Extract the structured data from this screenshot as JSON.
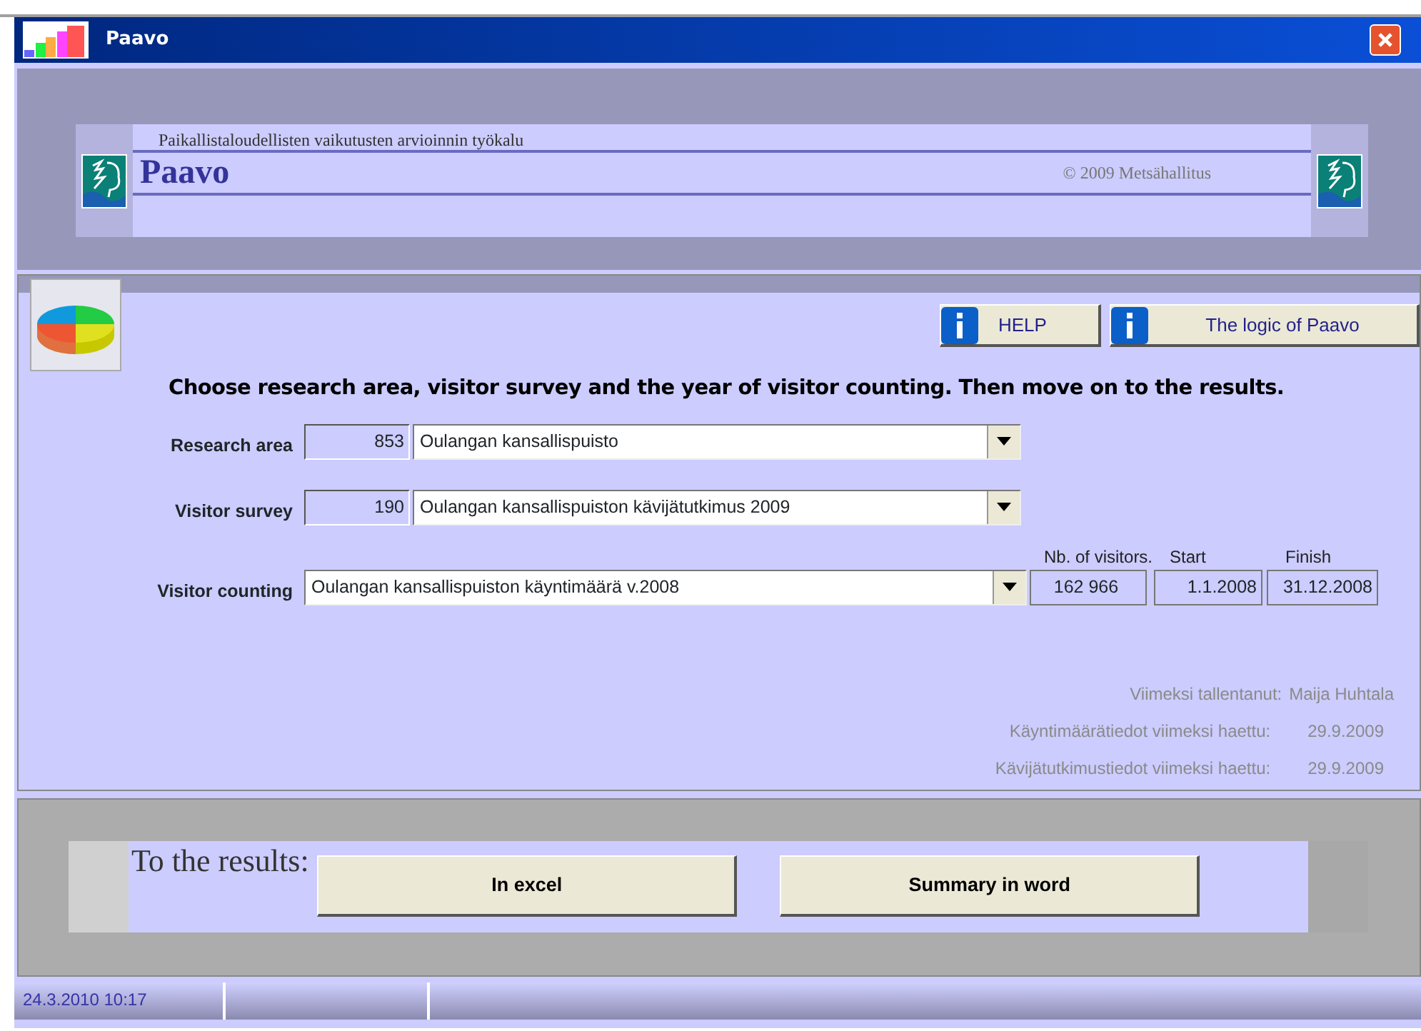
{
  "window": {
    "title": "Paavo"
  },
  "header": {
    "subtitle": "Paikallistaloudellisten vaikutusten arvioinnin työkalu",
    "title": "Paavo",
    "copyright": "© 2009 Metsähallitus"
  },
  "help_buttons": [
    "HELP",
    "The logic of Paavo"
  ],
  "instruction": "Choose research area, visitor survey and the year of visitor counting. Then move on to the results.",
  "selections": [
    {
      "label": "Research area",
      "code": "853",
      "value": "Oulangan kansallispuisto"
    },
    {
      "label": "Visitor survey",
      "code": "190",
      "value": "Oulangan kansallispuiston kävijätutkimus 2009"
    }
  ],
  "visitor_counting": {
    "label": "Visitor counting",
    "value": "Oulangan kansallispuiston käyntimäärä v.2008",
    "columns": [
      {
        "heading": "Nb. of visitors.",
        "value": "162 966"
      },
      {
        "heading": "Start",
        "value": "1.1.2008"
      },
      {
        "heading": "Finish",
        "value": "31.12.2008"
      }
    ]
  },
  "info": [
    {
      "label": "Viimeksi tallentanut:",
      "value": "Maija Huhtala"
    },
    {
      "label": "Käyntimäärätiedot viimeksi haettu:",
      "value": "29.9.2009"
    },
    {
      "label": "Kävijätutkimustiedot viimeksi haettu:",
      "value": "29.9.2009"
    }
  ],
  "results": {
    "label": "To the results:",
    "buttons": [
      "In excel",
      "Summary in word"
    ]
  },
  "status_bar": {
    "datetime": "24.3.2010 10:17"
  }
}
